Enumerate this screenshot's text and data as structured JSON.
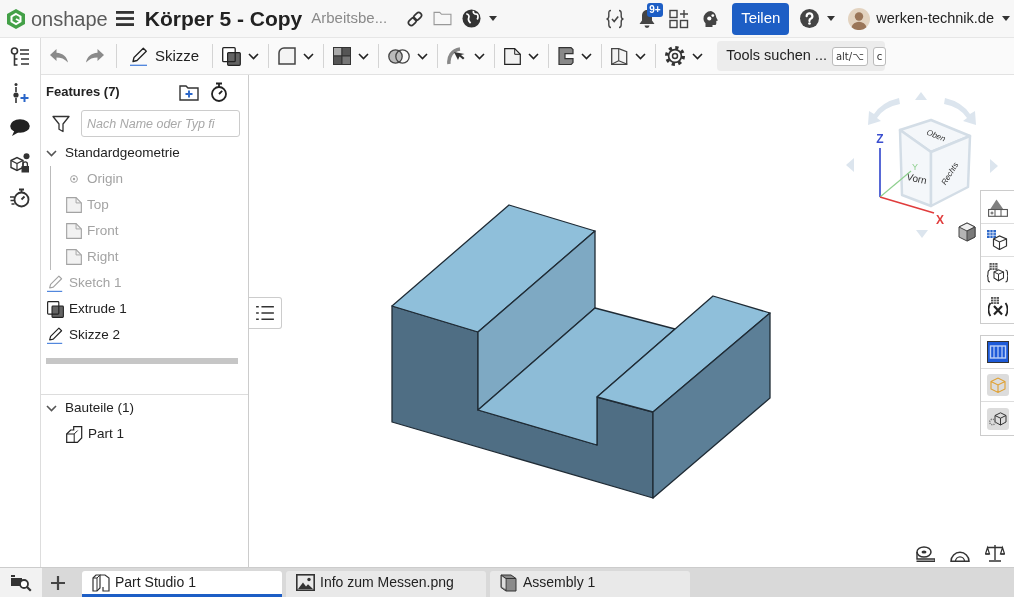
{
  "topbar": {
    "logo": "onshape",
    "title": "Körper 5 - Copy",
    "workspace": "Arbeitsbe...",
    "doc_actions": [
      {
        "kind": "link",
        "dropdown": false
      },
      {
        "kind": "folder",
        "dropdown": false
      },
      {
        "kind": "globe",
        "dropdown": true
      }
    ],
    "app_actions": [
      {
        "kind": "variables"
      },
      {
        "kind": "notifications",
        "badge": "9+"
      },
      {
        "kind": "apps"
      },
      {
        "kind": "assistant"
      }
    ],
    "share_button": "Teilen",
    "help": {
      "dropdown": true
    },
    "user": {
      "name": "werken-technik.de",
      "dropdown": true
    }
  },
  "toolbar": {
    "tools": [
      {
        "kind": "undo",
        "dropdown": false
      },
      {
        "kind": "redo",
        "dropdown": false
      },
      {
        "kind": "sketch",
        "label": "Skizze",
        "dropdown": false
      },
      {
        "kind": "extrude",
        "dropdown": true
      },
      {
        "kind": "fillet",
        "dropdown": true
      },
      {
        "kind": "pattern",
        "dropdown": true
      },
      {
        "kind": "boolean",
        "dropdown": true
      },
      {
        "kind": "transform",
        "dropdown": true
      },
      {
        "kind": "plane",
        "dropdown": true
      },
      {
        "kind": "sweep",
        "dropdown": true
      },
      {
        "kind": "shell",
        "dropdown": true
      },
      {
        "kind": "settings",
        "dropdown": true
      }
    ],
    "search": {
      "label": "Tools suchen ...",
      "keys": [
        "alt/⌥",
        "c"
      ]
    }
  },
  "rail": [
    {
      "kind": "featurelist"
    },
    {
      "kind": "addpoint"
    },
    {
      "kind": "comments"
    },
    {
      "kind": "partinfo"
    },
    {
      "kind": "performance"
    }
  ],
  "features": {
    "title": "Features (7)",
    "header_actions": [
      {
        "kind": "addfolder"
      },
      {
        "kind": "stopwatch"
      }
    ],
    "filter_placeholder": "Nach Name oder Typ fi",
    "tree": [
      {
        "label": "Standardgeometrie",
        "kind": "group",
        "expanded": true,
        "children": [
          {
            "label": "Origin",
            "kind": "origin",
            "greyed": true
          },
          {
            "label": "Top",
            "kind": "plane",
            "greyed": true
          },
          {
            "label": "Front",
            "kind": "plane",
            "greyed": true
          },
          {
            "label": "Right",
            "kind": "plane",
            "greyed": true
          }
        ]
      },
      {
        "label": "Sketch 1",
        "kind": "sketch",
        "greyed": true
      },
      {
        "label": "Extrude 1",
        "kind": "extrude",
        "greyed": false
      },
      {
        "label": "Skizze 2",
        "kind": "sketch",
        "greyed": false
      }
    ],
    "parts_tree": [
      {
        "label": "Bauteile (1)",
        "kind": "group",
        "expanded": true,
        "children": [
          {
            "label": "Part 1",
            "kind": "part",
            "greyed": false
          }
        ]
      }
    ]
  },
  "viewport": {
    "view_cube": {
      "faces": [
        "Oben",
        "Vorn",
        "Rechts"
      ],
      "axes": [
        "Z",
        "Y",
        "X"
      ]
    },
    "view_mode": {
      "kind": "shaded"
    },
    "right_toolbar": [
      {
        "tools": [
          {
            "kind": "appearance"
          },
          {
            "kind": "rendergrid"
          },
          {
            "kind": "variablecube"
          },
          {
            "kind": "function"
          }
        ]
      },
      {
        "tools": [
          {
            "kind": "app"
          },
          {
            "kind": "cubeoutline"
          },
          {
            "kind": "cubegear"
          }
        ]
      }
    ],
    "measure_tools": [
      {
        "kind": "tape"
      },
      {
        "kind": "protractor"
      },
      {
        "kind": "scale"
      }
    ]
  },
  "tabbar": {
    "actions": [
      {
        "kind": "tabsearch"
      },
      {
        "kind": "add"
      }
    ],
    "tabs": [
      {
        "label": "Part Studio 1",
        "kind": "partstudio",
        "selected": true
      },
      {
        "label": "Info zum Messen.png",
        "kind": "image",
        "selected": false
      },
      {
        "label": "Assembly 1",
        "kind": "assembly",
        "selected": false
      }
    ]
  }
}
